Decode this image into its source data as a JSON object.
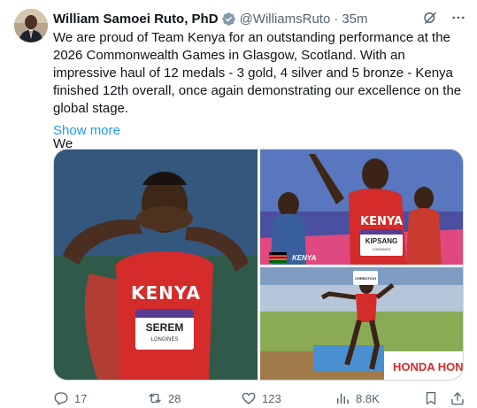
{
  "author": {
    "name": "William Samoei Ruto, PhD",
    "handle": "@WilliamsRuto",
    "separator": "·",
    "time": "35m"
  },
  "post": {
    "paragraph1": "We are proud of Team Kenya for an outstanding performance at the 2026 Commonwealth Games in Glasgow, Scotland. With an impressive haul of 12 medals - 3 gold, 4 silver and 5 bronze - Kenya finished 12th overall, once again demonstrating our excellence on the global stage.",
    "paragraph2": "We",
    "show_more": "Show more"
  },
  "media": {
    "left_bib_name": "SEREM",
    "left_bib_sponsor": "LONGINES",
    "left_vest_text": "KENYA",
    "tr_bib_name": "KIPSANG",
    "tr_bib_sponsor": "LONGINES",
    "tr_vest_text": "KENYA",
    "tr_banner_text": "KENYA",
    "br_bib_name": "CHEBOTICH",
    "br_board_text": "HONDA HON"
  },
  "stats": {
    "replies": "17",
    "reposts": "28",
    "likes": "123",
    "views": "8.8K"
  },
  "icons": {
    "verified": "verified-badge-icon",
    "grok": "grok-icon",
    "more": "more-icon",
    "reply": "reply-icon",
    "repost": "repost-icon",
    "like": "heart-icon",
    "views": "views-icon",
    "bookmark": "bookmark-icon",
    "share": "share-icon"
  },
  "colors": {
    "accent": "#1d9bf0",
    "text": "#0f1419",
    "muted": "#536471",
    "kenya_red": "#d62b2b"
  }
}
